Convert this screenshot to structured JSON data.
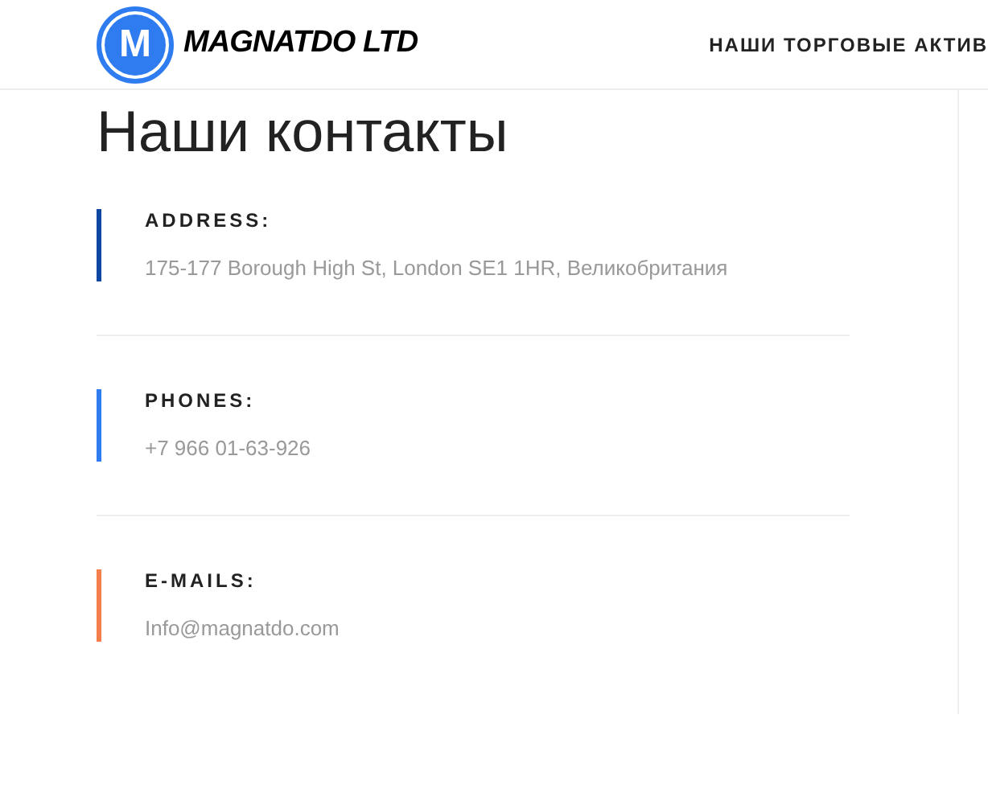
{
  "header": {
    "logo_mark": "M",
    "brand": "MAGNATDO LTD",
    "nav": [
      "НАШИ ТОРГОВЫЕ АКТИВ"
    ]
  },
  "title": "Наши контакты",
  "contacts": [
    {
      "label": "ADDRESS:",
      "value": "175-177 Borough High St, London SE1 1HR, Великобритания",
      "color": "#0d47a1"
    },
    {
      "label": "PHONES:",
      "value": "+7 966 01-63-926",
      "color": "#2f7cf0"
    },
    {
      "label": "E-MAILS:",
      "value": "Info@magnatdo.com",
      "color": "#f47f4c"
    }
  ]
}
